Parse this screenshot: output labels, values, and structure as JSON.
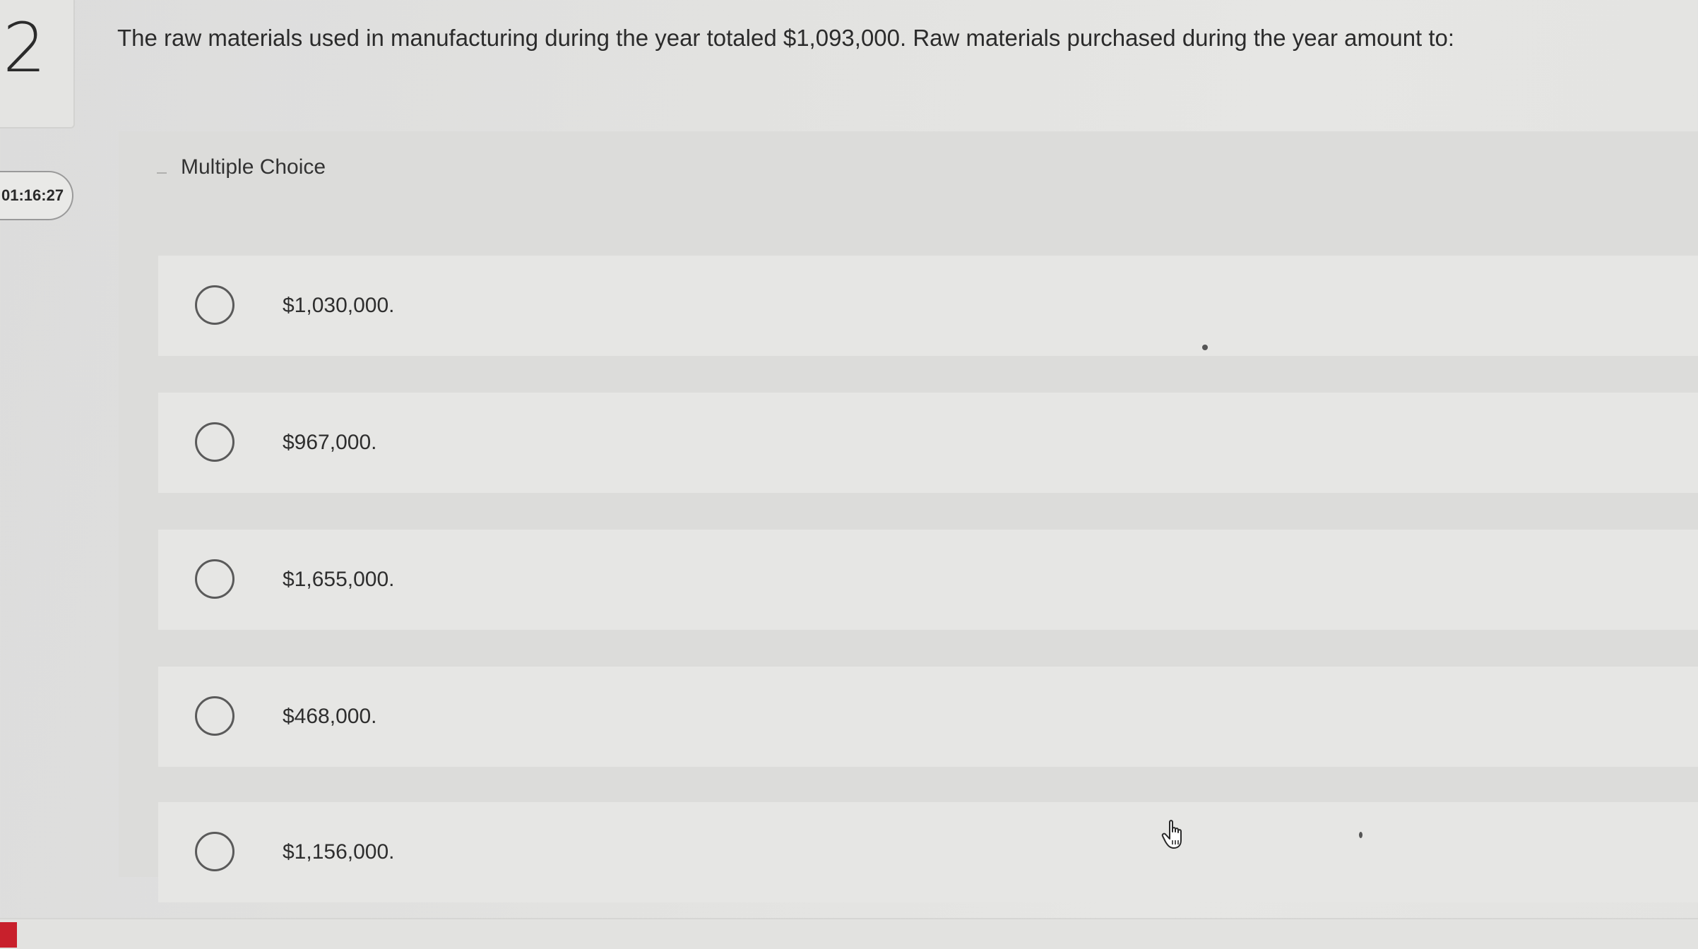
{
  "question": {
    "number": "2",
    "timer": "01:16:27",
    "text": "The raw materials used in manufacturing during the year totaled $1,093,000. Raw materials purchased during the year amount to:"
  },
  "multiple_choice": {
    "label": "Multiple Choice",
    "options": [
      {
        "label": "$1,030,000."
      },
      {
        "label": "$967,000."
      },
      {
        "label": "$1,655,000."
      },
      {
        "label": "$468,000."
      },
      {
        "label": "$1,156,000."
      }
    ]
  },
  "icons": {
    "radio": "radio-unselected-icon",
    "cursor": "hand-pointer-icon"
  },
  "colors": {
    "accent_red": "#c8202c"
  }
}
